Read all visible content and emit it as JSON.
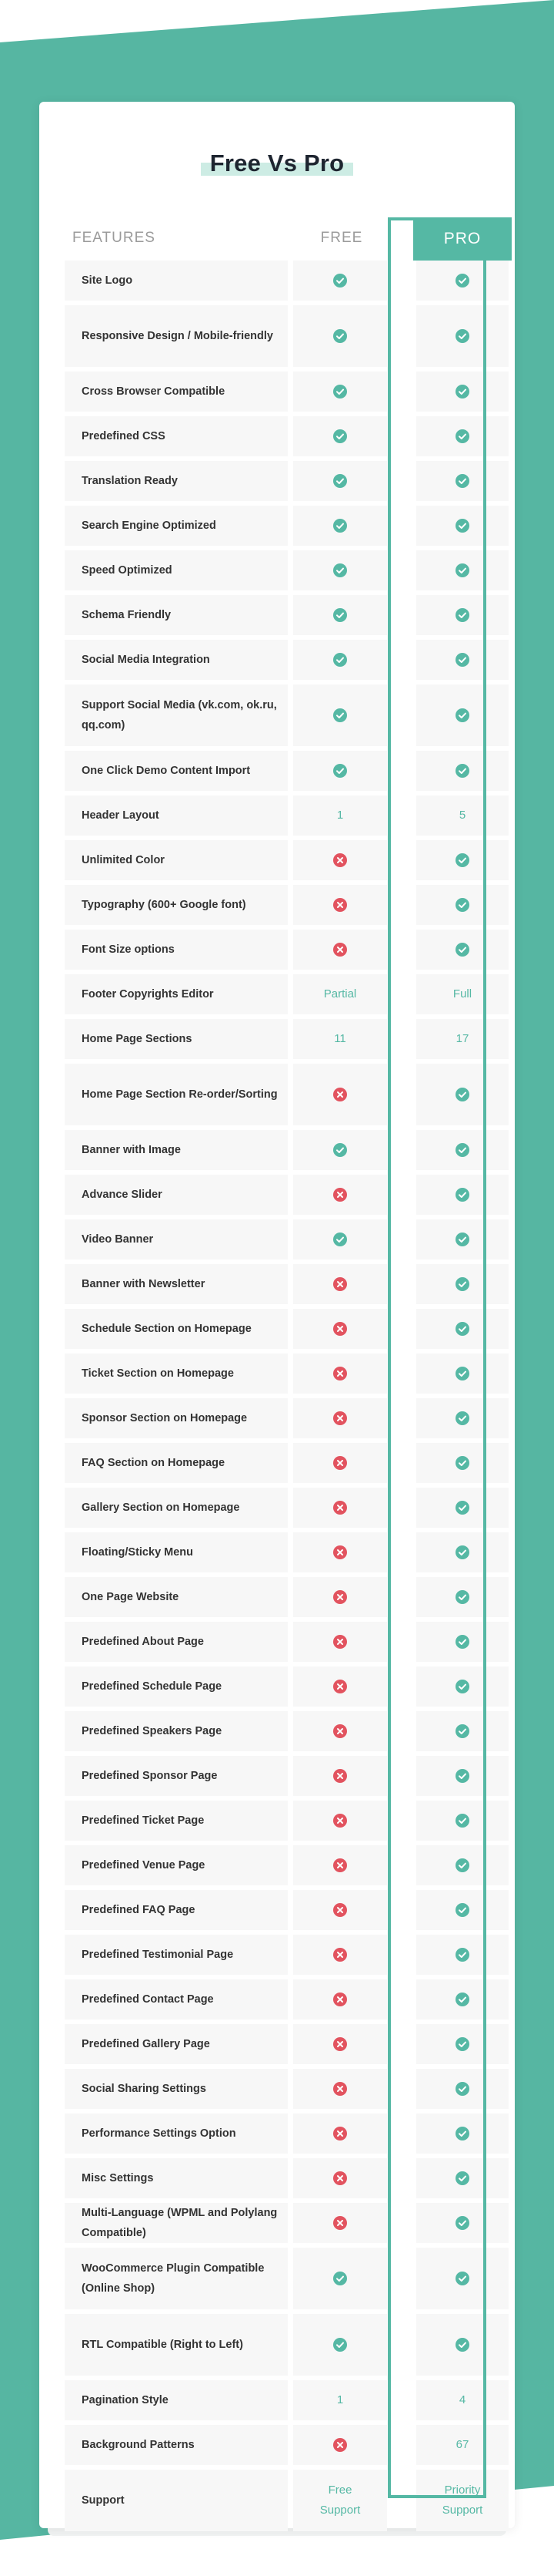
{
  "colors": {
    "accent": "#55b8a4",
    "cross": "#e2535f",
    "teal_bg": "#56b6a2"
  },
  "title": "Free Vs Pro",
  "header": {
    "features": "FEATURES",
    "free": "FREE",
    "pro": "PRO"
  },
  "rows": [
    {
      "feature": "Site Logo",
      "free": {
        "type": "check"
      },
      "pro": {
        "type": "check"
      }
    },
    {
      "feature": "Responsive Design / Mobile-friendly",
      "free": {
        "type": "check"
      },
      "pro": {
        "type": "check"
      }
    },
    {
      "feature": "Cross Browser Compatible",
      "free": {
        "type": "check"
      },
      "pro": {
        "type": "check"
      }
    },
    {
      "feature": "Predefined CSS",
      "free": {
        "type": "check"
      },
      "pro": {
        "type": "check"
      }
    },
    {
      "feature": "Translation Ready",
      "free": {
        "type": "check"
      },
      "pro": {
        "type": "check"
      }
    },
    {
      "feature": "Search Engine Optimized",
      "free": {
        "type": "check"
      },
      "pro": {
        "type": "check"
      }
    },
    {
      "feature": "Speed Optimized",
      "free": {
        "type": "check"
      },
      "pro": {
        "type": "check"
      }
    },
    {
      "feature": "Schema Friendly",
      "free": {
        "type": "check"
      },
      "pro": {
        "type": "check"
      }
    },
    {
      "feature": "Social Media Integration",
      "free": {
        "type": "check"
      },
      "pro": {
        "type": "check"
      }
    },
    {
      "feature": "Support Social Media (vk.com, ok.ru, qq.com)",
      "free": {
        "type": "check"
      },
      "pro": {
        "type": "check"
      }
    },
    {
      "feature": "One Click Demo Content Import",
      "free": {
        "type": "check"
      },
      "pro": {
        "type": "check"
      }
    },
    {
      "feature": "Header Layout",
      "free": {
        "type": "text",
        "value": "1"
      },
      "pro": {
        "type": "text",
        "value": "5"
      }
    },
    {
      "feature": "Unlimited Color",
      "free": {
        "type": "cross"
      },
      "pro": {
        "type": "check"
      }
    },
    {
      "feature": "Typography (600+ Google font)",
      "free": {
        "type": "cross"
      },
      "pro": {
        "type": "check"
      }
    },
    {
      "feature": "Font Size options",
      "free": {
        "type": "cross"
      },
      "pro": {
        "type": "check"
      }
    },
    {
      "feature": "Footer Copyrights Editor",
      "free": {
        "type": "text",
        "value": "Partial"
      },
      "pro": {
        "type": "text",
        "value": "Full"
      }
    },
    {
      "feature": "Home Page Sections",
      "free": {
        "type": "text",
        "value": "11"
      },
      "pro": {
        "type": "text",
        "value": "17"
      }
    },
    {
      "feature": "Home Page Section Re-order/Sorting",
      "free": {
        "type": "cross"
      },
      "pro": {
        "type": "check"
      }
    },
    {
      "feature": "Banner with Image",
      "free": {
        "type": "check"
      },
      "pro": {
        "type": "check"
      }
    },
    {
      "feature": "Advance Slider",
      "free": {
        "type": "cross"
      },
      "pro": {
        "type": "check"
      }
    },
    {
      "feature": "Video Banner",
      "free": {
        "type": "check"
      },
      "pro": {
        "type": "check"
      }
    },
    {
      "feature": "Banner with Newsletter",
      "free": {
        "type": "cross"
      },
      "pro": {
        "type": "check"
      }
    },
    {
      "feature": "Schedule Section on Homepage",
      "free": {
        "type": "cross"
      },
      "pro": {
        "type": "check"
      }
    },
    {
      "feature": "Ticket Section on Homepage",
      "free": {
        "type": "cross"
      },
      "pro": {
        "type": "check"
      }
    },
    {
      "feature": "Sponsor Section on Homepage",
      "free": {
        "type": "cross"
      },
      "pro": {
        "type": "check"
      }
    },
    {
      "feature": "FAQ Section on Homepage",
      "free": {
        "type": "cross"
      },
      "pro": {
        "type": "check"
      }
    },
    {
      "feature": "Gallery Section on Homepage",
      "free": {
        "type": "cross"
      },
      "pro": {
        "type": "check"
      }
    },
    {
      "feature": "Floating/Sticky Menu",
      "free": {
        "type": "cross"
      },
      "pro": {
        "type": "check"
      }
    },
    {
      "feature": "One Page Website",
      "free": {
        "type": "cross"
      },
      "pro": {
        "type": "check"
      }
    },
    {
      "feature": "Predefined About Page",
      "free": {
        "type": "cross"
      },
      "pro": {
        "type": "check"
      }
    },
    {
      "feature": "Predefined Schedule Page",
      "free": {
        "type": "cross"
      },
      "pro": {
        "type": "check"
      }
    },
    {
      "feature": "Predefined Speakers Page",
      "free": {
        "type": "cross"
      },
      "pro": {
        "type": "check"
      }
    },
    {
      "feature": "Predefined Sponsor Page",
      "free": {
        "type": "cross"
      },
      "pro": {
        "type": "check"
      }
    },
    {
      "feature": "Predefined Ticket Page",
      "free": {
        "type": "cross"
      },
      "pro": {
        "type": "check"
      }
    },
    {
      "feature": "Predefined Venue Page",
      "free": {
        "type": "cross"
      },
      "pro": {
        "type": "check"
      }
    },
    {
      "feature": "Predefined FAQ Page",
      "free": {
        "type": "cross"
      },
      "pro": {
        "type": "check"
      }
    },
    {
      "feature": "Predefined Testimonial Page",
      "free": {
        "type": "cross"
      },
      "pro": {
        "type": "check"
      }
    },
    {
      "feature": "Predefined Contact Page",
      "free": {
        "type": "cross"
      },
      "pro": {
        "type": "check"
      }
    },
    {
      "feature": "Predefined Gallery Page",
      "free": {
        "type": "cross"
      },
      "pro": {
        "type": "check"
      }
    },
    {
      "feature": "Social Sharing Settings",
      "free": {
        "type": "cross"
      },
      "pro": {
        "type": "check"
      }
    },
    {
      "feature": "Performance Settings Option",
      "free": {
        "type": "cross"
      },
      "pro": {
        "type": "check"
      }
    },
    {
      "feature": "Misc Settings",
      "free": {
        "type": "cross"
      },
      "pro": {
        "type": "check"
      }
    },
    {
      "feature": "Multi-Language (WPML and Polylang Compatible)",
      "free": {
        "type": "cross"
      },
      "pro": {
        "type": "check"
      }
    },
    {
      "feature": "WooCommerce Plugin Compatible (Online Shop)",
      "free": {
        "type": "check"
      },
      "pro": {
        "type": "check"
      }
    },
    {
      "feature": "RTL Compatible (Right to Left)",
      "free": {
        "type": "check"
      },
      "pro": {
        "type": "check"
      }
    },
    {
      "feature": "Pagination Style",
      "free": {
        "type": "text",
        "value": "1"
      },
      "pro": {
        "type": "text",
        "value": "4"
      }
    },
    {
      "feature": "Background Patterns",
      "free": {
        "type": "cross"
      },
      "pro": {
        "type": "text",
        "value": "67"
      }
    },
    {
      "feature": "Support",
      "free": {
        "type": "text",
        "value": "Free Support"
      },
      "pro": {
        "type": "text",
        "value": "Priority Support"
      }
    }
  ]
}
